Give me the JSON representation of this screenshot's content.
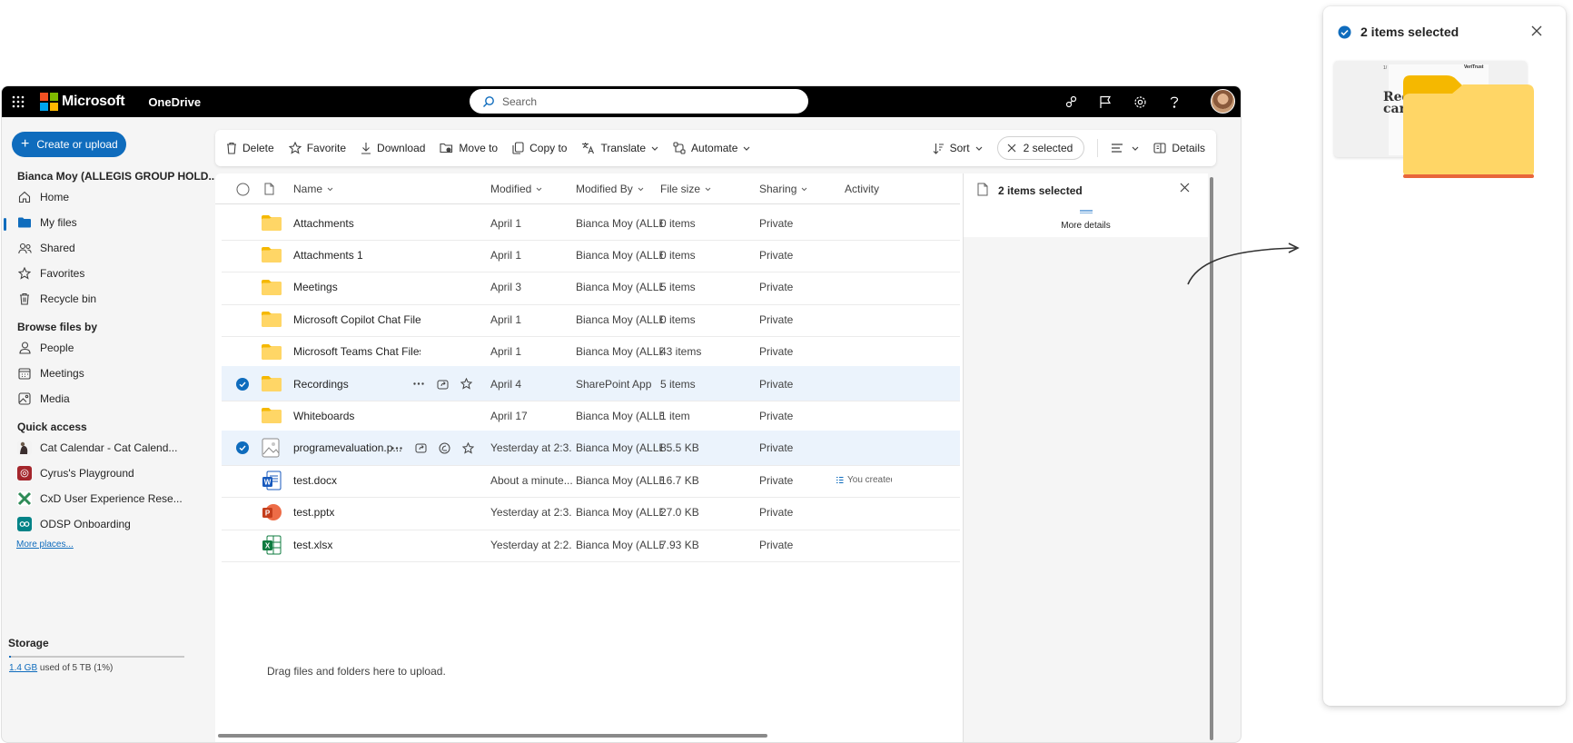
{
  "topbar": {
    "brand": "Microsoft",
    "app_name": "OneDrive",
    "search_placeholder": "Search"
  },
  "sidebar": {
    "create_label": "Create or upload",
    "account": "Bianca Moy (ALLEGIS GROUP HOLD...",
    "nav": [
      {
        "label": "Home",
        "icon": "home-icon"
      },
      {
        "label": "My files",
        "icon": "folder-icon",
        "active": true
      },
      {
        "label": "Shared",
        "icon": "people-icon"
      },
      {
        "label": "Favorites",
        "icon": "star-icon"
      },
      {
        "label": "Recycle bin",
        "icon": "trash-icon"
      }
    ],
    "browse_title": "Browse files by",
    "browse": [
      {
        "label": "People",
        "icon": "person-icon"
      },
      {
        "label": "Meetings",
        "icon": "calendar-icon"
      },
      {
        "label": "Media",
        "icon": "image-icon"
      }
    ],
    "quick_title": "Quick access",
    "quick": [
      {
        "label": "Cat Calendar - Cat Calend...",
        "color": "#6b5a4a"
      },
      {
        "label": "Cyrus's Playground",
        "color": "#a4262c"
      },
      {
        "label": "CxD User Experience Rese...",
        "color": "#2e8b57"
      },
      {
        "label": "ODSP Onboarding",
        "color": "#038387"
      }
    ],
    "more_places": "More places...",
    "storage_title": "Storage",
    "storage_used": "1.4 GB",
    "storage_rest": " used of 5 TB (1%)",
    "storage_fraction": 0.01
  },
  "commands": {
    "delete": "Delete",
    "favorite": "Favorite",
    "download": "Download",
    "move_to": "Move to",
    "copy_to": "Copy to",
    "translate": "Translate",
    "automate": "Automate",
    "sort": "Sort",
    "selected": "2 selected",
    "details": "Details"
  },
  "columns": {
    "name": "Name",
    "modified": "Modified",
    "modified_by": "Modified By",
    "file_size": "File size",
    "sharing": "Sharing",
    "activity": "Activity"
  },
  "files": [
    {
      "name": "Attachments",
      "type": "folder",
      "modified": "April 1",
      "by": "Bianca Moy (ALLEG",
      "size": "0 items",
      "sharing": "Private",
      "activity": "",
      "selected": false
    },
    {
      "name": "Attachments 1",
      "type": "folder",
      "modified": "April 1",
      "by": "Bianca Moy (ALLEG",
      "size": "0 items",
      "sharing": "Private",
      "activity": "",
      "selected": false
    },
    {
      "name": "Meetings",
      "type": "folder",
      "modified": "April 3",
      "by": "Bianca Moy (ALLEG",
      "size": "5 items",
      "sharing": "Private",
      "activity": "",
      "selected": false
    },
    {
      "name": "Microsoft Copilot Chat Files",
      "type": "folder",
      "modified": "April 1",
      "by": "Bianca Moy (ALLEG",
      "size": "0 items",
      "sharing": "Private",
      "activity": "",
      "selected": false
    },
    {
      "name": "Microsoft Teams Chat Files",
      "type": "folder",
      "modified": "April 1",
      "by": "Bianca Moy (ALLEG",
      "size": "43 items",
      "sharing": "Private",
      "activity": "",
      "selected": false
    },
    {
      "name": "Recordings",
      "type": "folder",
      "modified": "April 4",
      "by": "SharePoint App",
      "size": "5 items",
      "sharing": "Private",
      "activity": "",
      "selected": true
    },
    {
      "name": "Whiteboards",
      "type": "folder",
      "modified": "April 17",
      "by": "Bianca Moy (ALLEG",
      "size": "1 item",
      "sharing": "Private",
      "activity": "",
      "selected": false
    },
    {
      "name": "programevaluation.p...",
      "type": "image",
      "modified": "Yesterday at 2:3...",
      "by": "Bianca Moy (ALLEG",
      "size": "85.5 KB",
      "sharing": "Private",
      "activity": "",
      "selected": true
    },
    {
      "name": "test.docx",
      "type": "word",
      "modified": "About a minute...",
      "by": "Bianca Moy (ALLEG",
      "size": "16.7 KB",
      "sharing": "Private",
      "activity": "You created",
      "selected": false
    },
    {
      "name": "test.pptx",
      "type": "powerpoint",
      "modified": "Yesterday at 2:3...",
      "by": "Bianca Moy (ALLEG",
      "size": "27.0 KB",
      "sharing": "Private",
      "activity": "",
      "selected": false
    },
    {
      "name": "test.xlsx",
      "type": "excel",
      "modified": "Yesterday at 2:2...",
      "by": "Bianca Moy (ALLEG",
      "size": "7.93 KB",
      "sharing": "Private",
      "activity": "",
      "selected": false
    }
  ],
  "drag_hint": "Drag files and folders here to upload.",
  "details_pane": {
    "title": "2 items selected",
    "more_details": "More details"
  },
  "card": {
    "title": "2 items selected",
    "thumb_text": "Red carb",
    "thumb_brand": "VeriTrust"
  },
  "colors": {
    "accent": "#0f6cbd",
    "folder": "#ffd666",
    "folder_tab": "#f5b800",
    "selected_row": "#ebf3fc"
  }
}
